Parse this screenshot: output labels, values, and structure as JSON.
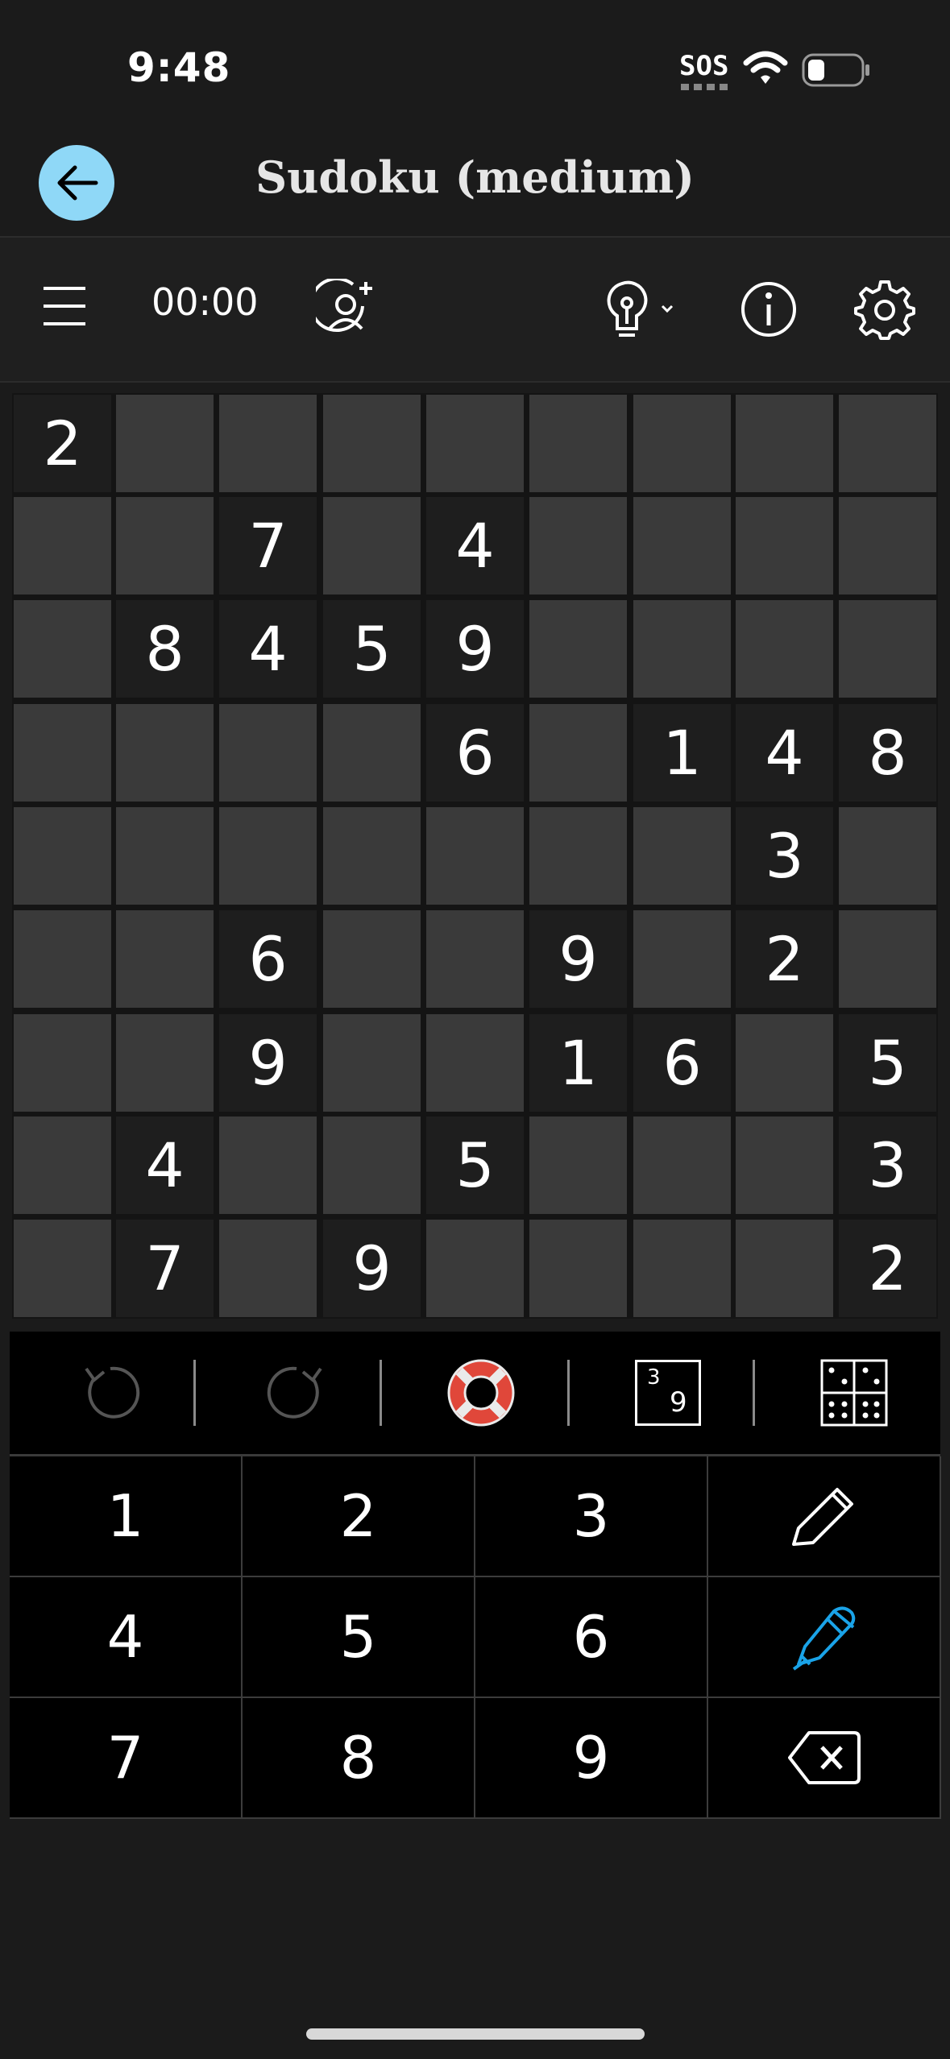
{
  "status_bar": {
    "time": "9:48",
    "sos": "SOS"
  },
  "app_bar": {
    "title": "Sudoku (medium)"
  },
  "toolbar": {
    "timer": "00:00"
  },
  "board": {
    "rows": [
      [
        "2",
        "",
        "",
        "",
        "",
        "",
        "",
        "",
        ""
      ],
      [
        "",
        "",
        "7",
        "",
        "4",
        "",
        "",
        "",
        ""
      ],
      [
        "",
        "8",
        "4",
        "5",
        "9",
        "",
        "",
        "",
        ""
      ],
      [
        "",
        "",
        "",
        "",
        "6",
        "",
        "1",
        "4",
        "8"
      ],
      [
        "",
        "",
        "",
        "",
        "",
        "",
        "",
        "3",
        ""
      ],
      [
        "",
        "",
        "6",
        "",
        "",
        "9",
        "",
        "2",
        ""
      ],
      [
        "",
        "",
        "9",
        "",
        "",
        "1",
        "6",
        "",
        "5"
      ],
      [
        "",
        "4",
        "",
        "",
        "5",
        "",
        "",
        "",
        "3"
      ],
      [
        "",
        "7",
        "",
        "9",
        "",
        "",
        "",
        "",
        "2"
      ]
    ]
  },
  "controls": {
    "notes_icon_digits": [
      "3",
      "9"
    ]
  },
  "keypad": {
    "digits": [
      "1",
      "2",
      "3",
      "4",
      "5",
      "6",
      "7",
      "8",
      "9"
    ]
  },
  "colors": {
    "background": "#1b1b1b",
    "empty_cell": "#3a3a3a",
    "given_cell": "#1e1e1e",
    "back_button": "#8fd8f7",
    "pen_active": "#1aa3e8",
    "hint_red": "#e0473a"
  },
  "icons": {
    "back": "arrow-left-icon",
    "menu": "hamburger-icon",
    "add_player": "add-user-icon",
    "hint": "lightbulb-icon",
    "info": "info-icon",
    "settings": "gear-icon",
    "undo": "undo-icon",
    "redo": "redo-icon",
    "help": "lifebuoy-icon",
    "notes": "notes-icon",
    "grid": "grid-icon",
    "pencil": "pencil-icon",
    "pen": "pen-icon",
    "erase": "backspace-icon"
  }
}
